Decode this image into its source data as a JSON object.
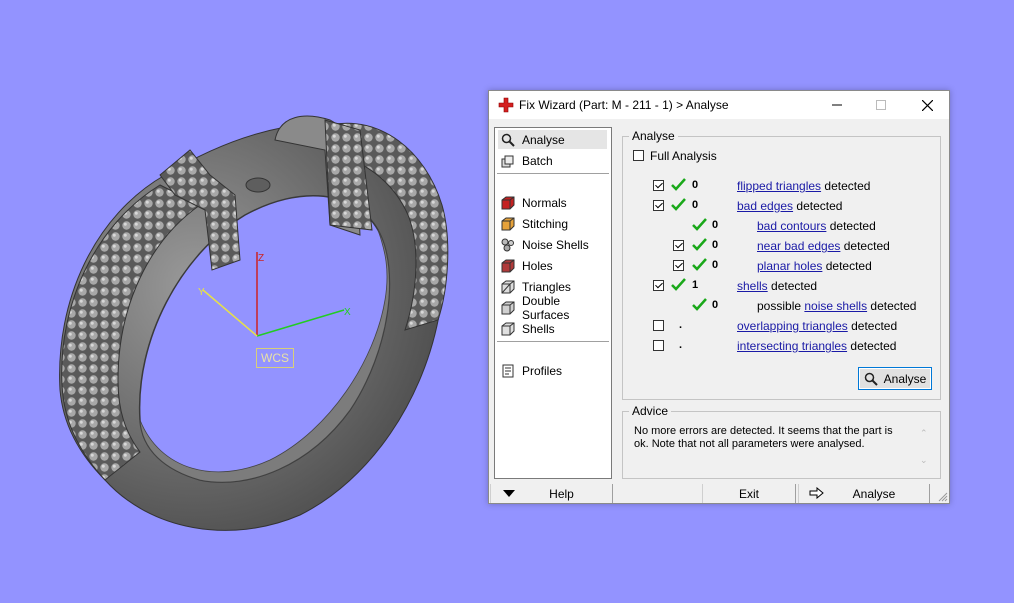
{
  "viewport": {
    "wcs_label": "WCS",
    "axes": {
      "x": "X",
      "y": "Y",
      "z": "Z"
    },
    "colors": {
      "x_axis": "#22cc22",
      "y_axis": "#e6e04a",
      "z_axis": "#cc2222",
      "background": "#9393ff"
    }
  },
  "dialog": {
    "title": "Fix Wizard (Part: M - 211 - 1) > Analyse",
    "window_buttons": {
      "minimize": "minimize-icon",
      "maximize": "maximize-icon",
      "close": "close-icon"
    },
    "nav": [
      {
        "label": "Analyse",
        "icon": "magnifier-icon",
        "selected": true
      },
      {
        "label": "Batch",
        "icon": "batch-icon"
      },
      {
        "label": "Normals",
        "icon": "normals-cube-icon"
      },
      {
        "label": "Stitching",
        "icon": "stitching-cube-icon"
      },
      {
        "label": "Noise Shells",
        "icon": "noise-shells-icon"
      },
      {
        "label": "Holes",
        "icon": "holes-cube-icon"
      },
      {
        "label": "Triangles",
        "icon": "triangles-cube-icon"
      },
      {
        "label": "Double Surfaces",
        "icon": "double-surfaces-icon"
      },
      {
        "label": "Shells",
        "icon": "shells-cube-icon"
      },
      {
        "label": "Profiles",
        "icon": "profiles-icon"
      }
    ],
    "analyse": {
      "group_title": "Analyse",
      "full_analysis": "Full Analysis",
      "detected": "detected",
      "possible": "possible",
      "rows": {
        "flipped": {
          "count": "0",
          "link": "flipped triangles"
        },
        "bad_edges": {
          "count": "0",
          "link": "bad edges"
        },
        "bad_contours": {
          "count": "0",
          "link": "bad contours"
        },
        "near_bad_edges": {
          "count": "0",
          "link": "near bad edges"
        },
        "planar_holes": {
          "count": "0",
          "link": "planar holes"
        },
        "shells": {
          "count": "1",
          "link": "shells"
        },
        "noise_shells": {
          "count": "0",
          "link": "noise shells"
        },
        "overlapping": {
          "count": ".",
          "link": "overlapping triangles"
        },
        "intersecting": {
          "count": ".",
          "link": "intersecting triangles"
        }
      },
      "analyse_button": "Analyse"
    },
    "advice": {
      "group_title": "Advice",
      "text": "No more errors are detected. It seems that the part is ok. Note that not all parameters were analysed."
    },
    "bottom": {
      "help": "Help",
      "exit": "Exit",
      "analyse": "Analyse"
    }
  }
}
